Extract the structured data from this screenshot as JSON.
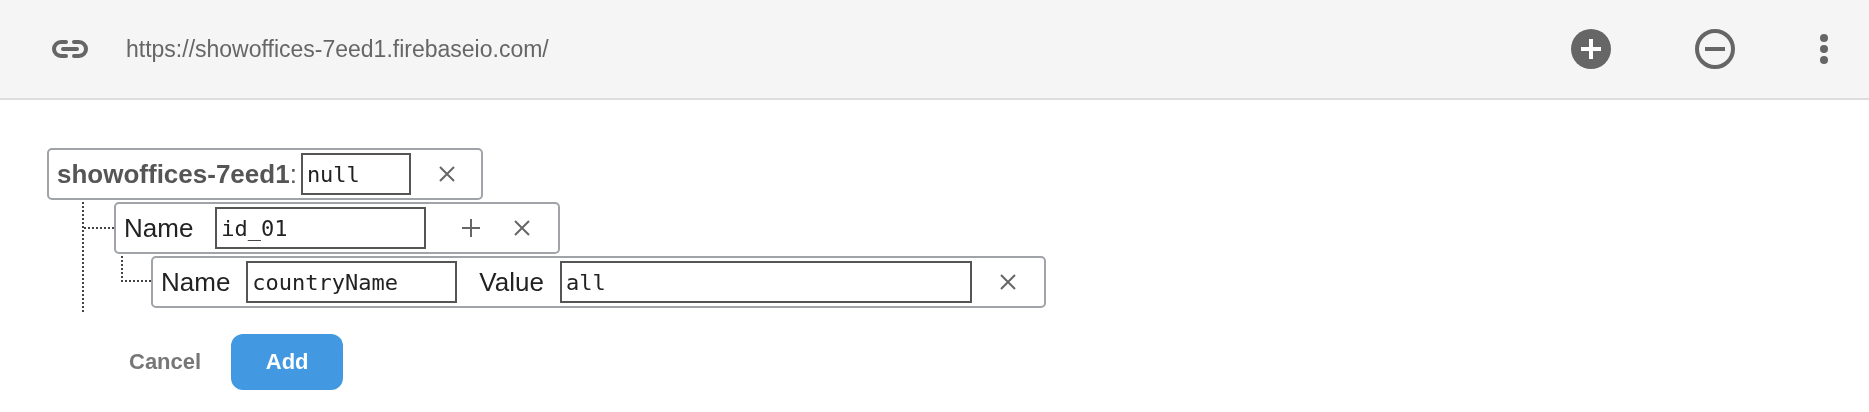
{
  "toolbar": {
    "url": "https://showoffices-7eed1.firebaseio.com/"
  },
  "tree": {
    "name": "showoffices-7eed1",
    "separator": ":",
    "value": "null",
    "children": [
      {
        "name_label": "Name",
        "name": "id_01",
        "children": [
          {
            "name_label": "Name",
            "name": "countryName",
            "value_label": "Value",
            "value": "all"
          }
        ]
      }
    ]
  },
  "buttons": {
    "cancel": "Cancel",
    "add": "Add"
  }
}
